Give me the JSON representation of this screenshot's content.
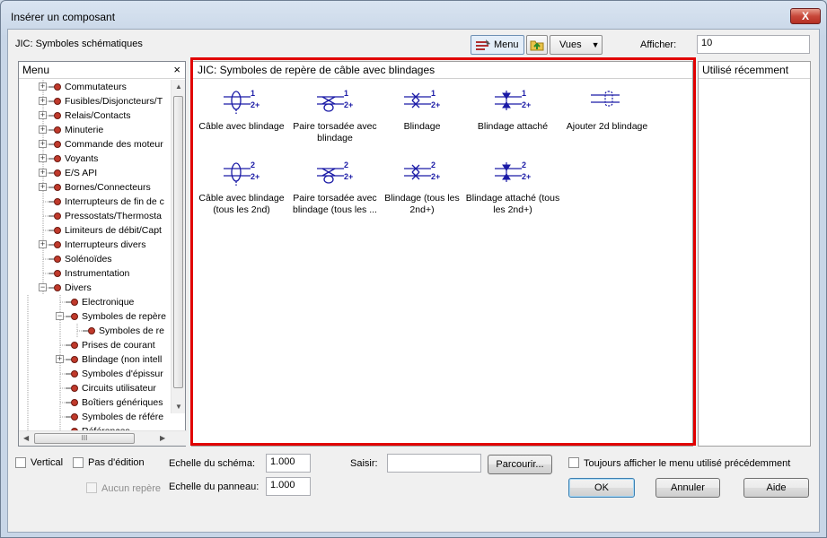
{
  "window": {
    "title": "Insérer un composant",
    "close": "X"
  },
  "toolbar": {
    "path": "JIC: Symboles schématiques",
    "menu_label": "Menu",
    "views_label": "Vues",
    "show_label": "Afficher:",
    "show_value": "10"
  },
  "left_panel": {
    "title": "Menu",
    "close": "×",
    "items": [
      {
        "label": "Commutateurs",
        "level": 0,
        "expander": "+"
      },
      {
        "label": "Fusibles/Disjoncteurs/T",
        "level": 0,
        "expander": "+"
      },
      {
        "label": "Relais/Contacts",
        "level": 0,
        "expander": "+"
      },
      {
        "label": "Minuterie",
        "level": 0,
        "expander": "+"
      },
      {
        "label": "Commande des moteur",
        "level": 0,
        "expander": "+"
      },
      {
        "label": "Voyants",
        "level": 0,
        "expander": "+"
      },
      {
        "label": "E/S API",
        "level": 0,
        "expander": "+"
      },
      {
        "label": "Bornes/Connecteurs",
        "level": 0,
        "expander": "+"
      },
      {
        "label": "Interrupteurs de fin de c",
        "level": 0,
        "expander": ""
      },
      {
        "label": "Pressostats/Thermosta",
        "level": 0,
        "expander": ""
      },
      {
        "label": "Limiteurs de débit/Capt",
        "level": 0,
        "expander": ""
      },
      {
        "label": "Interrupteurs divers",
        "level": 0,
        "expander": "+"
      },
      {
        "label": "Solénoïdes",
        "level": 0,
        "expander": ""
      },
      {
        "label": "Instrumentation",
        "level": 0,
        "expander": ""
      },
      {
        "label": "Divers",
        "level": 0,
        "expander": "−"
      },
      {
        "label": "Electronique",
        "level": 1,
        "expander": ""
      },
      {
        "label": "Symboles de repère",
        "level": 1,
        "expander": "−"
      },
      {
        "label": "Symboles de re",
        "level": 2,
        "expander": ""
      },
      {
        "label": "Prises de courant",
        "level": 1,
        "expander": ""
      },
      {
        "label": "Blindage (non intell",
        "level": 1,
        "expander": "+"
      },
      {
        "label": "Symboles d'épissur",
        "level": 1,
        "expander": ""
      },
      {
        "label": "Circuits utilisateur",
        "level": 1,
        "expander": ""
      },
      {
        "label": "Boîtiers génériques",
        "level": 1,
        "expander": ""
      },
      {
        "label": "Symboles de référe",
        "level": 1,
        "expander": ""
      },
      {
        "label": "Références",
        "level": 1,
        "expander": ""
      }
    ],
    "hscroll_grip": "III"
  },
  "main_panel": {
    "title": "JIC: Symboles de repère de câble avec blindages",
    "symbols": [
      {
        "label": "Câble avec blindage",
        "icon": "cable-shield-icon",
        "n1": "1",
        "n2": "2+"
      },
      {
        "label": "Paire torsadée avec blindage",
        "icon": "twisted-pair-shield-icon",
        "n1": "1",
        "n2": "2+"
      },
      {
        "label": "Blindage",
        "icon": "shield-icon",
        "n1": "1",
        "n2": "2+"
      },
      {
        "label": "Blindage attaché",
        "icon": "shield-attached-icon",
        "n1": "1",
        "n2": "2+"
      },
      {
        "label": "Ajouter 2d blindage",
        "icon": "add-shield-icon",
        "n1": "",
        "n2": ""
      },
      {
        "label": "Câble avec blindage (tous les 2nd)",
        "icon": "cable-shield-icon",
        "n1": "2",
        "n2": "2+"
      },
      {
        "label": "Paire torsadée avec blindage (tous les ...",
        "icon": "twisted-pair-shield-icon",
        "n1": "2",
        "n2": "2+"
      },
      {
        "label": "Blindage (tous les 2nd+)",
        "icon": "shield-icon",
        "n1": "2",
        "n2": "2+"
      },
      {
        "label": "Blindage attaché (tous les 2nd+)",
        "icon": "shield-attached-icon",
        "n1": "2",
        "n2": "2+"
      }
    ]
  },
  "right_panel": {
    "title": "Utilisé récemment"
  },
  "bottom": {
    "vertical_label": "Vertical",
    "no_edit_label": "Pas d'édition",
    "no_tag_label": "Aucun repère",
    "schema_scale_label": "Echelle du schéma:",
    "schema_scale_value": "1.000",
    "panel_scale_label": "Echelle du panneau:",
    "panel_scale_value": "1.000",
    "type_label": "Saisir:",
    "type_value": "",
    "browse_label": "Parcourir...",
    "always_show_label": "Toujours afficher le menu utilisé précédemment",
    "ok_label": "OK",
    "cancel_label": "Annuler",
    "help_label": "Aide"
  },
  "colors": {
    "highlight": "#e10000",
    "symbol_blue": "#1a1aa6",
    "node_red": "#c0392b"
  }
}
